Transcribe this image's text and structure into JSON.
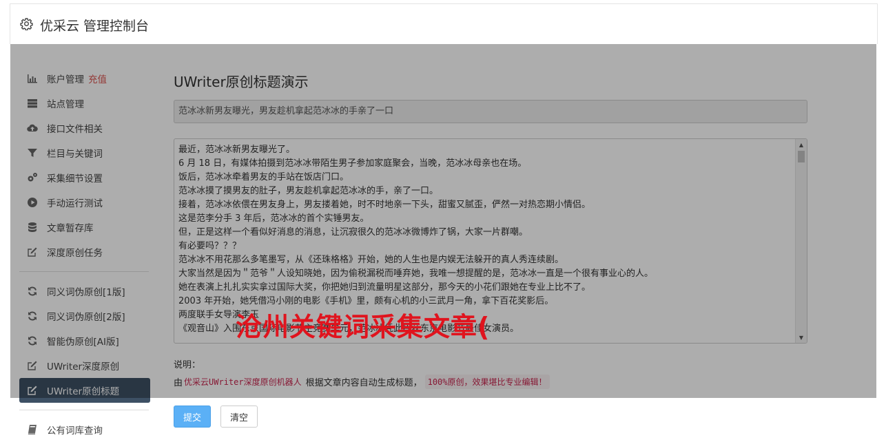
{
  "header": {
    "icon": "gear-icon",
    "title": "优采云 管理控制台"
  },
  "sidebar": {
    "groups": [
      {
        "items": [
          {
            "icon": "bar-chart-icon",
            "label": "账户管理",
            "badge": "充值"
          },
          {
            "icon": "server-icon",
            "label": "站点管理"
          },
          {
            "icon": "cloud-upload-icon",
            "label": "接口文件相关"
          },
          {
            "icon": "filter-icon",
            "label": "栏目与关键词"
          },
          {
            "icon": "gears-icon",
            "label": "采集细节设置"
          },
          {
            "icon": "play-circle-icon",
            "label": "手动运行测试"
          },
          {
            "icon": "database-icon",
            "label": "文章暂存库"
          },
          {
            "icon": "edit-icon",
            "label": "深度原创任务"
          }
        ]
      },
      {
        "items": [
          {
            "icon": "refresh-icon",
            "label": "同义词伪原创[1版]"
          },
          {
            "icon": "refresh-icon",
            "label": "同义词伪原创[2版]"
          },
          {
            "icon": "refresh-icon",
            "label": "智能伪原创[AI版]"
          },
          {
            "icon": "edit-icon",
            "label": "UWriter深度原创"
          },
          {
            "icon": "edit-icon",
            "label": "UWriter原创标题",
            "active": true
          }
        ]
      },
      {
        "items": [
          {
            "icon": "book-icon",
            "label": "公有词库查询"
          }
        ]
      }
    ]
  },
  "main": {
    "title": "UWriter原创标题演示",
    "title_input_value": "范冰冰新男友曝光，男友趁机拿起范冰冰的手亲了一口",
    "content_lines": [
      "最近，范冰冰新男友曝光了。",
      "6 月 18 日，有媒体拍摄到范冰冰带陌生男子参加家庭聚会，当晚，范冰冰母亲也在场。",
      "饭后，范冰冰牵着男友的手站在饭店门口。",
      "范冰冰摸了摸男友的肚子，男友趁机拿起范冰冰的手，亲了一口。",
      "接着，范冰冰依偎在男友身上，男友搂着她，时不时地亲一下头，甜蜜又腻歪，俨然一对热恋期小情侣。",
      "这是范李分手 3 年后，范冰冰的首个实锤男友。",
      "但，正是这样一个看似好消息的消息，让沉寂很久的范冰冰微博炸了锅，大家一片群嘲。",
      "有必要吗？？？",
      "范冰冰不用花那么多笔墨写，从《还珠格格》开始，她的人生也是内娱无法躲开的真人秀连续剧。",
      "大家当然是因为＂范爷＂人设知晓她，因为偷税漏税而唾弃她，我唯一想提醒的是，范冰冰一直是一个很有事业心的人。",
      "她在表演上扎扎实实拿过国际大奖，你把她归到流量明星这部分，那今天的小花们跟她在专业上比不了。",
      "2003 年开始，她凭借冯小刚的电影《手机》里，颇有心机的小三武月一角，拿下百花奖影后。",
      "两度联手女导演李玉",
      "《观音山》入围东京国际电影节主竞赛单元，范冰冰凭此片获东京电影节最佳女演员。"
    ],
    "watermark": "沧州关键词采集文章(",
    "note_label": "说明：",
    "note": {
      "prefix": "由",
      "highlight1": "优采云UWriter深度原创机器人",
      "middle": "根据文章内容自动生成标题，",
      "highlight2": "100%原创，效果堪比专业编辑！"
    },
    "buttons": {
      "submit": "提交",
      "clear": "清空"
    }
  },
  "colors": {
    "accent": "#5bb0f6",
    "active_nav": "#3d5064",
    "warn": "#d9534f",
    "code": "#c7254e",
    "watermark": "#e0141e"
  }
}
